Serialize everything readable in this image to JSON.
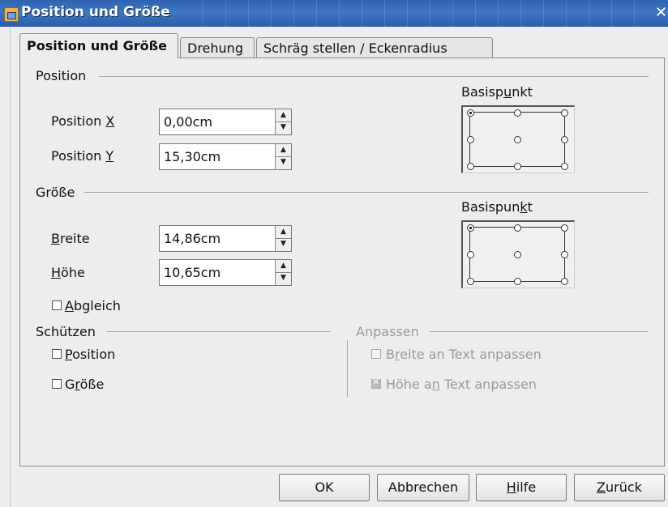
{
  "window": {
    "title": "Position und Größe",
    "close_glyph": "✕"
  },
  "tabs": [
    {
      "label": "Position und Größe",
      "active": true
    },
    {
      "label": "Drehung",
      "active": false
    },
    {
      "label": "Schräg stellen / Eckenradius",
      "active": false
    }
  ],
  "position": {
    "section_title": "Position",
    "x_label_pre": "Position ",
    "x_label_key": "X",
    "x_value": "0,00cm",
    "y_label_pre": "Position ",
    "y_label_key": "Y",
    "y_value": "15,30cm",
    "basis_label_pre": "Basisp",
    "basis_label_key": "u",
    "basis_label_post": "nkt",
    "basis_selected": "top-left"
  },
  "size": {
    "section_title": "Größe",
    "width_label_key": "B",
    "width_label_post": "reite",
    "width_value": "14,86cm",
    "height_label_key": "H",
    "height_label_post": "öhe",
    "height_value": "10,65cm",
    "keep_ratio_label_key": "A",
    "keep_ratio_label_post": "bgleich",
    "keep_ratio_checked": false,
    "basis_label_pre": "Basispun",
    "basis_label_key": "k",
    "basis_label_post": "t",
    "basis_selected": "top-left"
  },
  "protect": {
    "section_title": "Schützen",
    "position_label_key": "P",
    "position_label_post": "osition",
    "size_label_pre": "G",
    "size_label_key": "r",
    "size_label_post": "öße",
    "position_checked": false,
    "size_checked": false
  },
  "adapt": {
    "section_title": "Anpassen",
    "fit_width_pre": "B",
    "fit_width_key": "r",
    "fit_width_post": "eite an Text anpassen",
    "fit_height_pre": "Höhe a",
    "fit_height_key": "n",
    "fit_height_post": " Text anpassen",
    "fit_width_checked": false,
    "fit_height_checked": true,
    "enabled": false
  },
  "buttons": {
    "ok": "OK",
    "cancel": "Abbrechen",
    "help_key": "H",
    "help_post": "ilfe",
    "reset_key": "Z",
    "reset_post": "urück"
  },
  "icons": {
    "title": "dialog-app-icon",
    "spin_up": "▲",
    "spin_down": "▼"
  }
}
